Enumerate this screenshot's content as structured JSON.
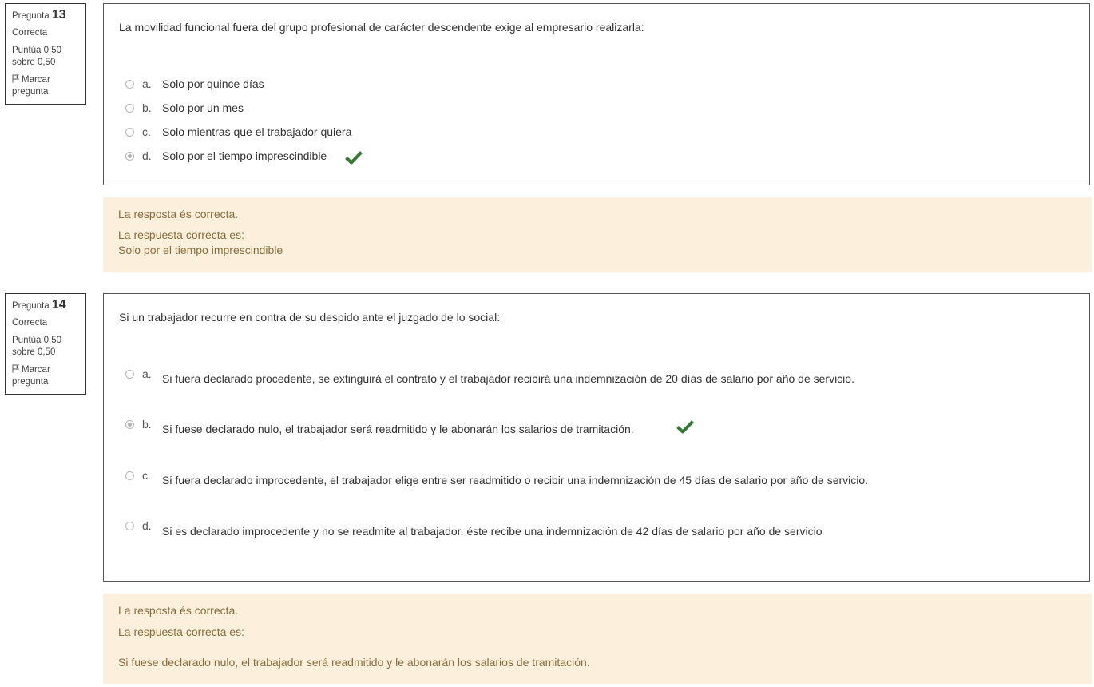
{
  "questions": [
    {
      "label": "Pregunta",
      "number": "13",
      "state": "Correcta",
      "grade_line1": "Puntúa 0,50",
      "grade_line2": "sobre 0,50",
      "flag_line1": "Marcar",
      "flag_line2": "pregunta",
      "text": "La movilidad funcional fuera del grupo profesional de carácter descendente exige al empresario realizarla:",
      "options": [
        {
          "letter": "a.",
          "text": "Solo por quince días",
          "selected": false
        },
        {
          "letter": "b.",
          "text": "Solo por un mes",
          "selected": false
        },
        {
          "letter": "c.",
          "text": "Solo mientras que el trabajador quiera",
          "selected": false
        },
        {
          "letter": "d.",
          "text": "Solo por el tiempo imprescindible",
          "selected": true,
          "correct_icon": "checkmark-icon"
        }
      ],
      "feedback": {
        "result": "La resposta és correcta.",
        "right_answer_label": "La respuesta correcta es:",
        "right_answer": "Solo por el tiempo imprescindible"
      }
    },
    {
      "label": "Pregunta",
      "number": "14",
      "state": "Correcta",
      "grade_line1": "Puntúa 0,50",
      "grade_line2": "sobre 0,50",
      "flag_line1": "Marcar",
      "flag_line2": "pregunta",
      "text": "Si un trabajador recurre en contra de su despido ante el juzgado de lo social:",
      "options": [
        {
          "letter": "a.",
          "text": "Si fuera declarado procedente, se extinguirá el contrato y el trabajador recibirá una indemnización de 20 días de salario por año de servicio.",
          "selected": false
        },
        {
          "letter": "b.",
          "text": "Si fuese declarado nulo, el trabajador será readmitido y le abonarán los salarios de tramitación.",
          "selected": true,
          "correct_icon": "checkmark-icon"
        },
        {
          "letter": "c.",
          "text": "Si fuera declarado improcedente, el trabajador elige entre ser readmitido o recibir una indemnización de 45 días de salario por año de servicio.",
          "selected": false
        },
        {
          "letter": "d.",
          "text": "Si es declarado improcedente y no se readmite al trabajador, éste recibe una indemnización de 42 días de salario por año de servicio",
          "selected": false
        }
      ],
      "feedback": {
        "result": "La resposta és correcta.",
        "right_answer_label": "La respuesta correcta es:",
        "right_answer": "Si fuese declarado nulo, el trabajador será readmitido y le abonarán los salarios de tramitación."
      }
    }
  ],
  "colors": {
    "feedback_bg": "#fcefdc",
    "feedback_text": "#8a6d3b",
    "checkmark": "#357a32",
    "border": "#555555"
  }
}
